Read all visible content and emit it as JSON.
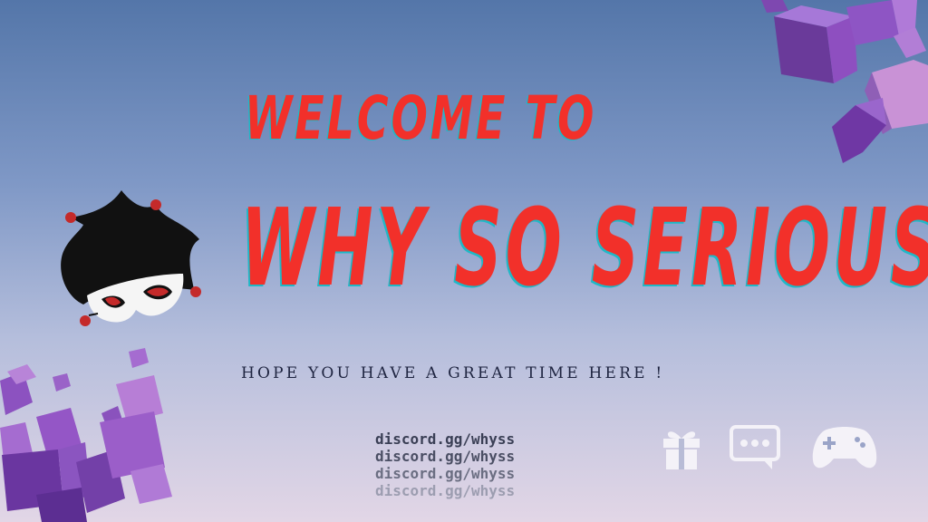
{
  "banner": {
    "welcome": "WELCOME TO",
    "title": "WHY SO SERIOUS",
    "tagline": "HOPE YOU HAVE A GREAT TIME HERE !",
    "links": [
      "discord.gg/whyss",
      "discord.gg/whyss",
      "discord.gg/whyss",
      "discord.gg/whyss"
    ],
    "link_colors": [
      "#3a3f55",
      "#4b4f64",
      "#6b6e82",
      "#9c9db0"
    ]
  },
  "icons": [
    "gift-icon",
    "chat-bubble-icon",
    "gamepad-icon"
  ],
  "decorations": [
    "jester-hat-mask-logo",
    "purple-cubes-top-right",
    "purple-cubes-bottom-left"
  ],
  "colors": {
    "title_red": "#f2302a",
    "title_shadow": "#1fb8c6",
    "tagline": "#1e2440",
    "cube_purple": "#7a3fa8",
    "icon_white": "#f4f2f8"
  }
}
